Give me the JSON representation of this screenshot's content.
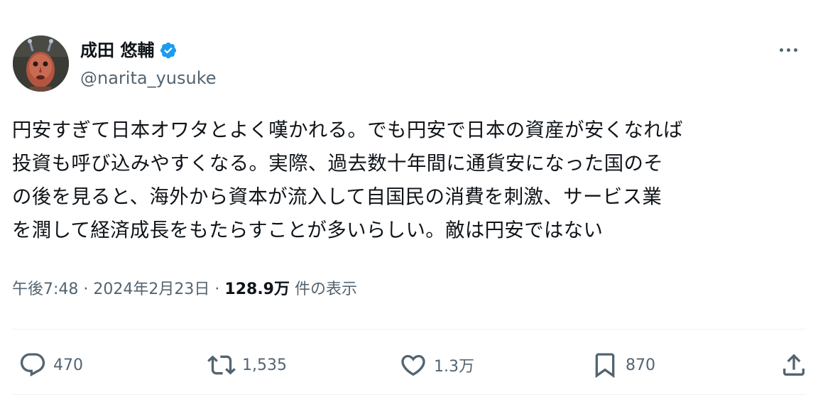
{
  "author": {
    "display_name": "成田 悠輔",
    "handle": "@narita_yusuke",
    "verified": true,
    "verified_color": "#1d9bf0"
  },
  "tweet": {
    "text_lines": [
      "円安すぎて日本オワタとよく嘆かれる。でも円安で日本の資産が安くなれば",
      "投資も呼び込みやすくなる。実際、過去数十年間に通貨安になった国のそ",
      "の後を見ると、海外から資本が流入して自国民の消費を刺激、サービス業",
      "を潤して経済成長をもたらすことが多いらしい。敵は円安ではない"
    ]
  },
  "meta": {
    "time": "午後7:48",
    "separator": "·",
    "date": "2024年2月23日",
    "views_count": "128.9万",
    "views_label": "件の表示"
  },
  "actions": {
    "reply_count": "470",
    "retweet_count": "1,535",
    "like_count": "1.3万",
    "bookmark_count": "870"
  },
  "icons": {
    "more": "more-horizontal-icon",
    "reply": "reply-bubble-icon",
    "retweet": "retweet-icon",
    "like": "heart-icon",
    "bookmark": "bookmark-icon",
    "share": "share-upload-icon",
    "verified": "verified-badge-icon"
  },
  "colors": {
    "text_primary": "#0f1419",
    "text_secondary": "#536471",
    "divider": "#eff3f4"
  }
}
